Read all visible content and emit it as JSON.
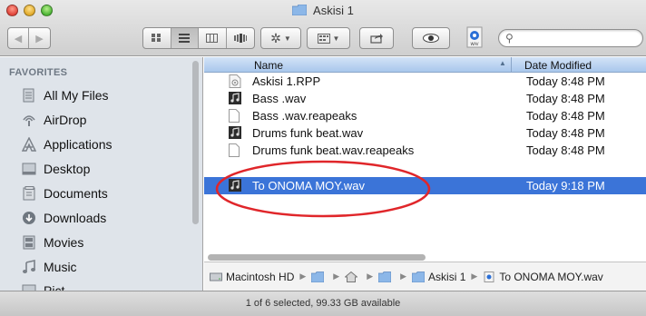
{
  "window": {
    "title": "Askisi 1"
  },
  "toolbar": {
    "back_icon": "chevron-left-icon",
    "forward_icon": "chevron-right-icon",
    "search_placeholder": ""
  },
  "sidebar": {
    "heading": "FAVORITES",
    "items": [
      {
        "label": "All My Files",
        "icon": "all-files-icon"
      },
      {
        "label": "AirDrop",
        "icon": "airdrop-icon"
      },
      {
        "label": "Applications",
        "icon": "applications-icon"
      },
      {
        "label": "Desktop",
        "icon": "desktop-icon"
      },
      {
        "label": "Documents",
        "icon": "documents-icon"
      },
      {
        "label": "Downloads",
        "icon": "downloads-icon"
      },
      {
        "label": "Movies",
        "icon": "movies-icon"
      },
      {
        "label": "Music",
        "icon": "music-icon"
      },
      {
        "label": "Pict...",
        "icon": "pictures-icon"
      }
    ]
  },
  "list": {
    "columns": {
      "name": "Name",
      "date": "Date Modified"
    },
    "rows": [
      {
        "name": "Askisi 1.RPP",
        "date": "Today 8:48 PM",
        "icon": "document-icon",
        "selected": false
      },
      {
        "name": "Bass .wav",
        "date": "Today 8:48 PM",
        "icon": "audio-file-icon",
        "selected": false
      },
      {
        "name": "Bass .wav.reapeaks",
        "date": "Today 8:48 PM",
        "icon": "blank-file-icon",
        "selected": false
      },
      {
        "name": "Drums funk beat.wav",
        "date": "Today 8:48 PM",
        "icon": "audio-file-icon",
        "selected": false
      },
      {
        "name": "Drums funk beat.wav.reapeaks",
        "date": "Today 8:48 PM",
        "icon": "blank-file-icon",
        "selected": false
      },
      {
        "name": "To ONOMA MOY.wav",
        "date": "Today 9:18 PM",
        "icon": "audio-file-icon",
        "selected": true
      }
    ]
  },
  "pathbar": {
    "crumbs": [
      {
        "label": "Macintosh HD",
        "icon": "hard-drive-icon"
      },
      {
        "label": "",
        "icon": "folder-icon"
      },
      {
        "label": "",
        "icon": "home-icon"
      },
      {
        "label": "",
        "icon": "folder-icon"
      },
      {
        "label": "Askisi 1",
        "icon": "folder-icon"
      },
      {
        "label": "To ONOMA MOY.wav",
        "icon": "audio-file-icon"
      }
    ]
  },
  "status": {
    "text": "1 of 6 selected, 99.33 GB available"
  },
  "colors": {
    "selection": "#3b74d8",
    "annotation": "#e0262a"
  }
}
